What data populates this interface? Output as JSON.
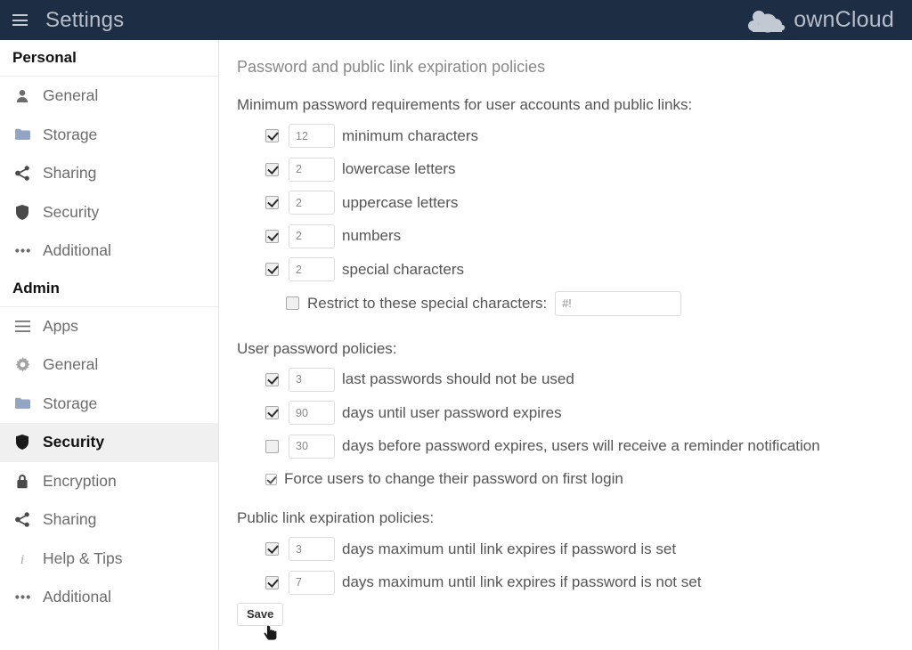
{
  "header": {
    "menu_icon": "hamburger-icon",
    "title": "Settings",
    "brand_icon": "owncloud-cloud-logo",
    "brand_name": "ownCloud"
  },
  "sidebar": {
    "groups": [
      {
        "heading": "Personal",
        "items": [
          {
            "label": "General",
            "icon": "user-icon",
            "active": false
          },
          {
            "label": "Storage",
            "icon": "folder-icon",
            "active": false
          },
          {
            "label": "Sharing",
            "icon": "share-icon",
            "active": false
          },
          {
            "label": "Security",
            "icon": "shield-icon",
            "active": false
          },
          {
            "label": "Additional",
            "icon": "ellipsis-icon",
            "active": false
          }
        ]
      },
      {
        "heading": "Admin",
        "items": [
          {
            "label": "Apps",
            "icon": "list-icon",
            "active": false
          },
          {
            "label": "General",
            "icon": "gear-icon",
            "active": false
          },
          {
            "label": "Storage",
            "icon": "folder-icon",
            "active": false
          },
          {
            "label": "Security",
            "icon": "shield-icon",
            "active": true
          },
          {
            "label": "Encryption",
            "icon": "lock-icon",
            "active": false
          },
          {
            "label": "Sharing",
            "icon": "share-icon",
            "active": false
          },
          {
            "label": "Help & Tips",
            "icon": "info-icon",
            "active": false
          },
          {
            "label": "Additional",
            "icon": "ellipsis-icon",
            "active": false
          }
        ]
      }
    ]
  },
  "main": {
    "section_title": "Password and public link expiration policies",
    "password_requirements": {
      "group_label": "Minimum password requirements for user accounts and public links:",
      "rows": [
        {
          "checked": true,
          "value": "12",
          "label": "minimum characters"
        },
        {
          "checked": true,
          "value": "2",
          "label": "lowercase letters"
        },
        {
          "checked": true,
          "value": "2",
          "label": "uppercase letters"
        },
        {
          "checked": true,
          "value": "2",
          "label": "numbers"
        },
        {
          "checked": true,
          "value": "2",
          "label": "special characters"
        }
      ],
      "restrict": {
        "checked": false,
        "label": "Restrict to these special characters:",
        "value": "#!"
      }
    },
    "user_password_policies": {
      "group_label": "User password policies:",
      "rows": [
        {
          "checked": true,
          "value": "3",
          "label": "last passwords should not be used"
        },
        {
          "checked": true,
          "value": "90",
          "label": "days until user password expires"
        },
        {
          "checked": false,
          "value": "30",
          "label": "days before password expires, users will receive a reminder notification"
        }
      ],
      "force_change": {
        "checked": true,
        "label": "Force users to change their password on first login"
      }
    },
    "public_link_policies": {
      "group_label": "Public link expiration policies:",
      "rows": [
        {
          "checked": true,
          "value": "3",
          "label": "days maximum until link expires if password is set"
        },
        {
          "checked": true,
          "value": "7",
          "label": "days maximum until link expires if password is not set"
        }
      ]
    },
    "save_label": "Save"
  },
  "colors": {
    "header_bg": "#1d2d44",
    "header_text": "#b7bec9",
    "active_nav_bg": "#f0f0f0",
    "body_text": "#555555",
    "muted_text": "#888888",
    "folder_icon": "#93a5c4"
  }
}
